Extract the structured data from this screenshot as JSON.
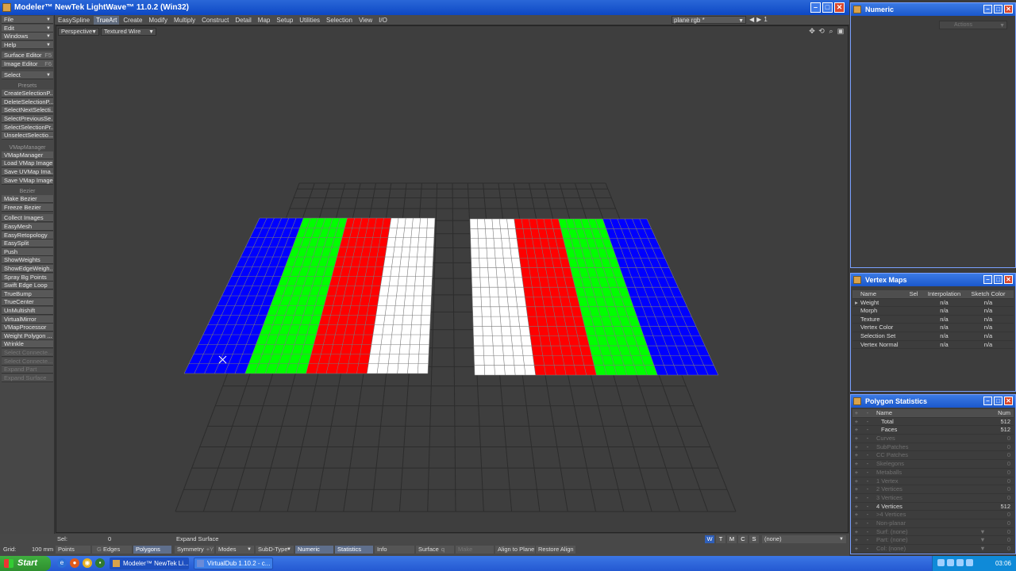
{
  "window": {
    "title": "Modeler™ NewTek LightWave™ 11.0.2 (Win32)"
  },
  "menu_tabs": [
    "EasySpline",
    "TrueArt",
    "Create",
    "Modify",
    "Multiply",
    "Construct",
    "Detail",
    "Map",
    "Setup",
    "Utilities",
    "Selection",
    "View",
    "I/O"
  ],
  "active_tab": "TrueArt",
  "header_right": {
    "plane": "plane rgb *",
    "page": "1"
  },
  "sidebar": {
    "top_menus": [
      "File",
      "Edit",
      "Windows",
      "Help"
    ],
    "surface_editor": "Surface Editor",
    "surface_key": "F5",
    "image_editor": "Image Editor",
    "image_key": "F6",
    "select": "Select",
    "presets_head": "Presets",
    "presets": [
      "CreateSelectionP...",
      "DeleteSelectionP...",
      "SelectNextSelecti...",
      "SelectPreviousSe...",
      "SelectSelectionPr...",
      "UnselectSelectio..."
    ],
    "vmap_head": "VMapManager",
    "vmap": [
      "VMapManager",
      "Load VMap Image",
      "Save UVMap Ima...",
      "Save VMap Image"
    ],
    "bezier_head": "Bezier",
    "bezier": [
      "Make Bezier",
      "Freeze Bezier"
    ],
    "tools": [
      "Collect Images",
      "EasyMesh",
      "EasyRetopology",
      "EasySplit",
      "Push",
      "ShowWeights",
      "ShowEdgeWeigh...",
      "Spray Bg Points",
      "Swift Edge Loop",
      "TrueBump",
      "TrueCenter",
      "UnMultishift",
      "VirtualMirror",
      "VMapProcessor",
      "Weight Polygon ...",
      "Wrinkle"
    ],
    "disabled": [
      "Select Connecte...",
      "Select Connecte...",
      "Expand Part",
      "Expand Surface"
    ]
  },
  "viewport": {
    "view": "Perspective",
    "shading": "Textured Wire"
  },
  "mesh": {
    "colors": {
      "blue": "#0000ff",
      "green": "#00ff00",
      "red": "#ff0000",
      "white": "#ffffff",
      "grid": "#2c2c2c",
      "wire": "#7a7a7a"
    },
    "left_bands": [
      "blue",
      "green",
      "red",
      "white"
    ],
    "right_bands": [
      "white",
      "red",
      "green",
      "blue"
    ],
    "cols_per_band": 6,
    "rows": 16
  },
  "numeric_panel": {
    "title": "Numeric",
    "actions": "Actions"
  },
  "vertex_maps": {
    "title": "Vertex Maps",
    "headers": [
      "Name",
      "Sel",
      "Interpolation",
      "Sketch Color"
    ],
    "rows": [
      {
        "name": "Weight",
        "interp": "n/a",
        "sketch": "n/a"
      },
      {
        "name": "Morph",
        "interp": "n/a",
        "sketch": "n/a"
      },
      {
        "name": "Texture",
        "interp": "n/a",
        "sketch": "n/a"
      },
      {
        "name": "Vertex Color",
        "interp": "n/a",
        "sketch": "n/a"
      },
      {
        "name": "Selection Set",
        "interp": "n/a",
        "sketch": "n/a"
      },
      {
        "name": "Vertex Normal",
        "interp": "n/a",
        "sketch": "n/a"
      }
    ]
  },
  "polygon_stats": {
    "title": "Polygon Statistics",
    "headers": [
      "Name",
      "Num"
    ],
    "rows": [
      {
        "name": "Total",
        "num": "512",
        "dim": false
      },
      {
        "name": "Faces",
        "num": "512",
        "dim": false
      },
      {
        "name": "Curves",
        "num": "0",
        "dim": true
      },
      {
        "name": "SubPatches",
        "num": "0",
        "dim": true
      },
      {
        "name": "CC Patches",
        "num": "0",
        "dim": true
      },
      {
        "name": "Skelegons",
        "num": "0",
        "dim": true
      },
      {
        "name": "Metaballs",
        "num": "0",
        "dim": true
      },
      {
        "name": "1 Vertex",
        "num": "0",
        "dim": true
      },
      {
        "name": "2 Vertices",
        "num": "0",
        "dim": true
      },
      {
        "name": "3 Vertices",
        "num": "0",
        "dim": true
      },
      {
        "name": "4 Vertices",
        "num": "512",
        "dim": false
      },
      {
        "name": ">4 Vertices",
        "num": "0",
        "dim": true
      },
      {
        "name": "Non-planar",
        "num": "0",
        "dim": true
      },
      {
        "name": "Surf: (none)",
        "num": "0",
        "dim": true
      },
      {
        "name": "Part: (none)",
        "num": "0",
        "dim": true
      },
      {
        "name": "Col: (none)",
        "num": "0",
        "dim": true
      }
    ]
  },
  "status": {
    "sel_label": "Sel:",
    "sel_value": "0",
    "expand": "Expand Surface",
    "layers": [
      "W",
      "T",
      "M",
      "C",
      "S"
    ],
    "layer_value": "(none)",
    "grid_label": "Grid:",
    "grid_value": "100 mm",
    "points": "Points",
    "edges": "Edges",
    "edges_key": "G",
    "polygons": "Polygons",
    "symmetry": "Symmetry",
    "symmetry_key": "+Y",
    "modes": "Modes",
    "subd": "SubD-Type",
    "numeric": "Numeric",
    "statistics": "Statistics",
    "info": "Info",
    "surface": "Surface",
    "surface_key": "q",
    "make": "Make",
    "align_plane": "Align to Plane",
    "restore_align": "Restore Align"
  },
  "taskbar": {
    "start": "Start",
    "items": [
      "Modeler™ NewTek Li...",
      "VirtualDub 1.10.2 - c..."
    ],
    "clock": "03:06"
  }
}
